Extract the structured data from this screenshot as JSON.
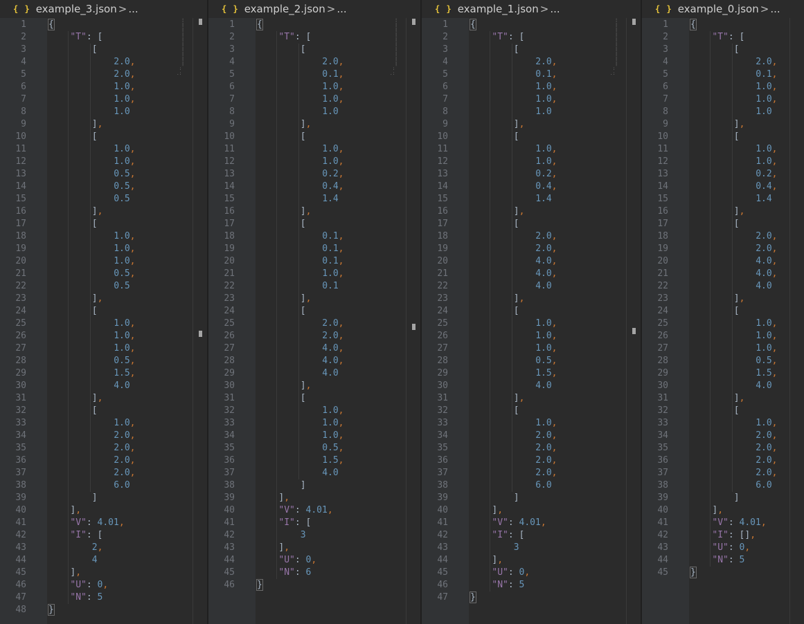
{
  "panes": [
    {
      "filename": "example_3.json",
      "breadcrumb": "...",
      "line_numbers": [
        "1",
        "2",
        "3",
        "4",
        "5",
        "6",
        "7",
        "8",
        "9",
        "10",
        "11",
        "12",
        "13",
        "14",
        "15",
        "16",
        "17",
        "18",
        "19",
        "20",
        "21",
        "22",
        "23",
        "24",
        "25",
        "26",
        "27",
        "28",
        "29",
        "30",
        "31",
        "32",
        "33",
        "34",
        "35",
        "36",
        "37",
        "38",
        "39",
        "40",
        "41",
        "42",
        "43",
        "44",
        "45",
        "46",
        "47",
        "48"
      ],
      "T": [
        [
          "2.0",
          "2.0",
          "1.0",
          "1.0",
          "1.0"
        ],
        [
          "1.0",
          "1.0",
          "0.5",
          "0.5",
          "0.5"
        ],
        [
          "1.0",
          "1.0",
          "1.0",
          "0.5",
          "0.5"
        ],
        [
          "1.0",
          "1.0",
          "1.0",
          "0.5",
          "1.5",
          "4.0"
        ],
        [
          "1.0",
          "2.0",
          "2.0",
          "2.0",
          "2.0",
          "6.0"
        ]
      ],
      "V": "4.01",
      "I": [
        "2",
        "4"
      ],
      "U": "0",
      "N": "5"
    },
    {
      "filename": "example_2.json",
      "breadcrumb": "...",
      "line_numbers": [
        "1",
        "2",
        "3",
        "4",
        "5",
        "6",
        "7",
        "8",
        "9",
        "10",
        "11",
        "12",
        "13",
        "14",
        "15",
        "16",
        "17",
        "18",
        "19",
        "20",
        "21",
        "22",
        "23",
        "24",
        "25",
        "26",
        "27",
        "28",
        "29",
        "30",
        "31",
        "32",
        "33",
        "34",
        "35",
        "36",
        "37",
        "38",
        "39",
        "40",
        "41",
        "42",
        "43",
        "44",
        "45",
        "46"
      ],
      "T": [
        [
          "2.0",
          "0.1",
          "1.0",
          "1.0",
          "1.0"
        ],
        [
          "1.0",
          "1.0",
          "0.2",
          "0.4",
          "1.4"
        ],
        [
          "0.1",
          "0.1",
          "0.1",
          "1.0",
          "0.1"
        ],
        [
          "2.0",
          "2.0",
          "4.0",
          "4.0",
          "4.0"
        ],
        [
          "1.0",
          "1.0",
          "1.0",
          "0.5",
          "1.5",
          "4.0"
        ]
      ],
      "V": "4.01",
      "I": [
        "3"
      ],
      "U": "0",
      "N": "6"
    },
    {
      "filename": "example_1.json",
      "breadcrumb": "...",
      "line_numbers": [
        "1",
        "2",
        "3",
        "4",
        "5",
        "6",
        "7",
        "8",
        "9",
        "10",
        "11",
        "12",
        "13",
        "14",
        "15",
        "16",
        "17",
        "18",
        "19",
        "20",
        "21",
        "22",
        "23",
        "24",
        "25",
        "26",
        "27",
        "28",
        "29",
        "30",
        "31",
        "32",
        "33",
        "34",
        "35",
        "36",
        "37",
        "38",
        "39",
        "40",
        "41",
        "42",
        "43",
        "44",
        "45",
        "46",
        "47"
      ],
      "T": [
        [
          "2.0",
          "0.1",
          "1.0",
          "1.0",
          "1.0"
        ],
        [
          "1.0",
          "1.0",
          "0.2",
          "0.4",
          "1.4"
        ],
        [
          "2.0",
          "2.0",
          "4.0",
          "4.0",
          "4.0"
        ],
        [
          "1.0",
          "1.0",
          "1.0",
          "0.5",
          "1.5",
          "4.0"
        ],
        [
          "1.0",
          "2.0",
          "2.0",
          "2.0",
          "2.0",
          "6.0"
        ]
      ],
      "V": "4.01",
      "I": [
        "3"
      ],
      "U": "0",
      "N": "5"
    },
    {
      "filename": "example_0.json",
      "breadcrumb": "...",
      "line_numbers": [
        "1",
        "2",
        "3",
        "4",
        "5",
        "6",
        "7",
        "8",
        "9",
        "10",
        "11",
        "12",
        "13",
        "14",
        "15",
        "16",
        "17",
        "18",
        "19",
        "20",
        "21",
        "22",
        "23",
        "24",
        "25",
        "26",
        "27",
        "28",
        "29",
        "30",
        "31",
        "32",
        "33",
        "34",
        "35",
        "36",
        "37",
        "38",
        "39",
        "40",
        "41",
        "42",
        "43",
        "44",
        "45"
      ],
      "T": [
        [
          "2.0",
          "0.1",
          "1.0",
          "1.0",
          "1.0"
        ],
        [
          "1.0",
          "1.0",
          "0.2",
          "0.4",
          "1.4"
        ],
        [
          "2.0",
          "2.0",
          "4.0",
          "4.0",
          "4.0"
        ],
        [
          "1.0",
          "1.0",
          "1.0",
          "0.5",
          "1.5",
          "4.0"
        ],
        [
          "1.0",
          "2.0",
          "2.0",
          "2.0",
          "2.0",
          "6.0"
        ]
      ],
      "V": "4.01",
      "I": [],
      "U": "0",
      "N": "5"
    }
  ],
  "icons": {
    "file_type": "json-file-icon",
    "breadcrumb_chevron": "chevron-right-icon"
  },
  "colors": {
    "background": "#2b2b2b",
    "gutter": "#313335",
    "key": "#9876aa",
    "number": "#6897bb",
    "punct": "#a9b7c6",
    "comma": "#cc7832",
    "file_icon": "#e8c53a"
  }
}
